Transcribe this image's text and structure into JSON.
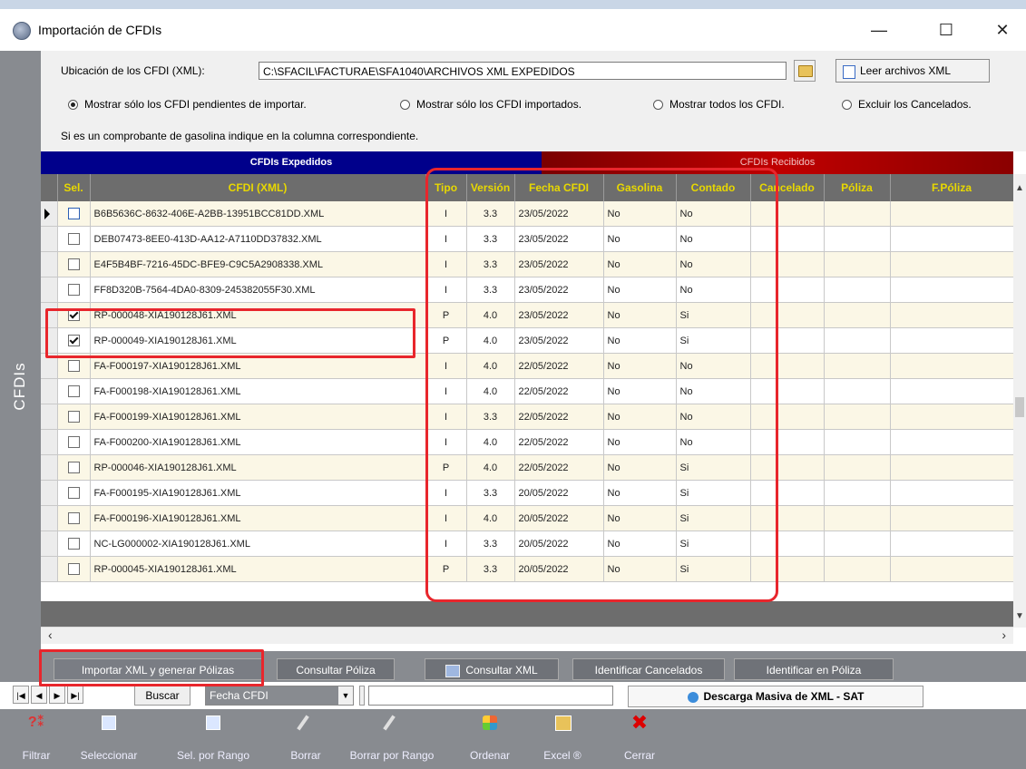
{
  "window": {
    "title": "Importación de CFDIs",
    "minimize": "—",
    "maximize": "☐",
    "close": "✕"
  },
  "side_tab": "CFDIs",
  "filters": {
    "location_label": "Ubicación de los CFDI (XML):",
    "path": "C:\\SFACIL\\FACTURAE\\SFA1040\\ARCHIVOS XML EXPEDIDOS",
    "read_button": "Leer archivos XML",
    "radio_pending": "Mostrar sólo los CFDI pendientes de importar.",
    "radio_imported": "Mostrar sólo los CFDI importados.",
    "radio_all": "Mostrar todos los CFDI.",
    "radio_exclude": "Excluir los Cancelados.",
    "gasoline_note": "Si es un comprobante de gasolina indique en la columna correspondiente."
  },
  "sections": {
    "issued": "CFDIs Expedidos",
    "received": "CFDIs Recibidos"
  },
  "columns": [
    "Sel.",
    "CFDI (XML)",
    "Tipo",
    "Versión",
    "Fecha CFDI",
    "Gasolina",
    "Contado",
    "Cancelado",
    "Póliza",
    "F.Póliza"
  ],
  "rows": [
    {
      "sel": false,
      "xml": "B6B5636C-8632-406E-A2BB-13951BCC81DD.XML",
      "tipo": "I",
      "version": "3.3",
      "fecha": "23/05/2022",
      "gasolina": "No",
      "contado": "No"
    },
    {
      "sel": false,
      "xml": "DEB07473-8EE0-413D-AA12-A7110DD37832.XML",
      "tipo": "I",
      "version": "3.3",
      "fecha": "23/05/2022",
      "gasolina": "No",
      "contado": "No"
    },
    {
      "sel": false,
      "xml": "E4F5B4BF-7216-45DC-BFE9-C9C5A2908338.XML",
      "tipo": "I",
      "version": "3.3",
      "fecha": "23/05/2022",
      "gasolina": "No",
      "contado": "No"
    },
    {
      "sel": false,
      "xml": "FF8D320B-7564-4DA0-8309-245382055F30.XML",
      "tipo": "I",
      "version": "3.3",
      "fecha": "23/05/2022",
      "gasolina": "No",
      "contado": "No"
    },
    {
      "sel": true,
      "xml": "RP-000048-XIA190128J61.XML",
      "tipo": "P",
      "version": "4.0",
      "fecha": "23/05/2022",
      "gasolina": "No",
      "contado": "Si"
    },
    {
      "sel": true,
      "xml": "RP-000049-XIA190128J61.XML",
      "tipo": "P",
      "version": "4.0",
      "fecha": "23/05/2022",
      "gasolina": "No",
      "contado": "Si"
    },
    {
      "sel": false,
      "xml": "FA-F000197-XIA190128J61.XML",
      "tipo": "I",
      "version": "4.0",
      "fecha": "22/05/2022",
      "gasolina": "No",
      "contado": "No"
    },
    {
      "sel": false,
      "xml": "FA-F000198-XIA190128J61.XML",
      "tipo": "I",
      "version": "4.0",
      "fecha": "22/05/2022",
      "gasolina": "No",
      "contado": "No"
    },
    {
      "sel": false,
      "xml": "FA-F000199-XIA190128J61.XML",
      "tipo": "I",
      "version": "3.3",
      "fecha": "22/05/2022",
      "gasolina": "No",
      "contado": "No"
    },
    {
      "sel": false,
      "xml": "FA-F000200-XIA190128J61.XML",
      "tipo": "I",
      "version": "4.0",
      "fecha": "22/05/2022",
      "gasolina": "No",
      "contado": "No"
    },
    {
      "sel": false,
      "xml": "RP-000046-XIA190128J61.XML",
      "tipo": "P",
      "version": "4.0",
      "fecha": "22/05/2022",
      "gasolina": "No",
      "contado": "Si"
    },
    {
      "sel": false,
      "xml": "FA-F000195-XIA190128J61.XML",
      "tipo": "I",
      "version": "3.3",
      "fecha": "20/05/2022",
      "gasolina": "No",
      "contado": "Si"
    },
    {
      "sel": false,
      "xml": "FA-F000196-XIA190128J61.XML",
      "tipo": "I",
      "version": "4.0",
      "fecha": "20/05/2022",
      "gasolina": "No",
      "contado": "Si"
    },
    {
      "sel": false,
      "xml": "NC-LG000002-XIA190128J61.XML",
      "tipo": "I",
      "version": "3.3",
      "fecha": "20/05/2022",
      "gasolina": "No",
      "contado": "Si"
    },
    {
      "sel": false,
      "xml": "RP-000045-XIA190128J61.XML",
      "tipo": "P",
      "version": "3.3",
      "fecha": "20/05/2022",
      "gasolina": "No",
      "contado": "Si"
    }
  ],
  "tabs": [
    "Importar XML y generar Pólizas",
    "Consultar Póliza",
    "Consultar XML",
    "Identificar Cancelados",
    "Identificar en Póliza"
  ],
  "navigator": {
    "search_label": "Buscar",
    "search_field": "Fecha CFDI",
    "sat_download": "Descarga Masiva de XML - SAT"
  },
  "toolbar": [
    "Filtrar",
    "Seleccionar",
    "Sel. por Rango",
    "Borrar",
    "Borrar por Rango",
    "Ordenar",
    "Excel ®",
    "Cerrar"
  ],
  "colors": {
    "issued_header": "#00008b",
    "received_header": "#a00000",
    "grid_header": "#6d6d6d",
    "header_text": "#e8d800",
    "highlight": "#e8262c"
  }
}
